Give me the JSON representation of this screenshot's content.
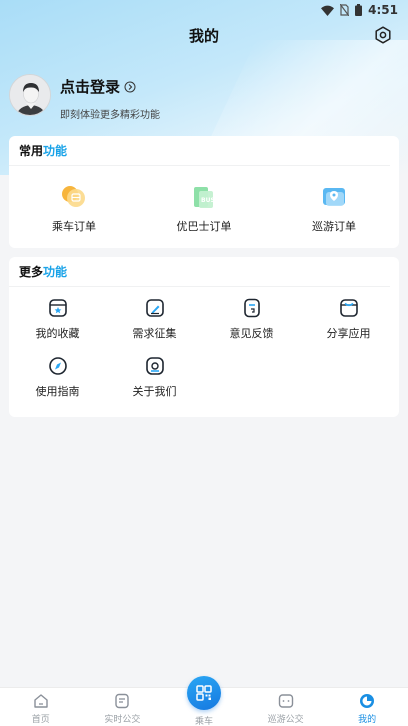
{
  "status_bar": {
    "time": "4:51"
  },
  "header": {
    "title": "我的"
  },
  "profile": {
    "login_label": "点击登录",
    "subtitle": "即刻体验更多精彩功能"
  },
  "common_section": {
    "title_dark": "常用",
    "title_accent": "功能",
    "items": [
      {
        "label": "乘车订单",
        "icon": "bus-order-icon"
      },
      {
        "label": "优巴士订单",
        "icon": "bus-ticket-icon"
      },
      {
        "label": "巡游订单",
        "icon": "map-pin-icon"
      }
    ]
  },
  "more_section": {
    "title_dark": "更多",
    "title_accent": "功能",
    "items": [
      {
        "label": "我的收藏",
        "icon": "star-box-icon"
      },
      {
        "label": "需求征集",
        "icon": "edit-icon"
      },
      {
        "label": "意见反馈",
        "icon": "feedback-icon"
      },
      {
        "label": "分享应用",
        "icon": "share-icon"
      },
      {
        "label": "使用指南",
        "icon": "compass-icon"
      },
      {
        "label": "关于我们",
        "icon": "about-icon"
      }
    ]
  },
  "tab_bar": {
    "items": [
      {
        "label": "首页",
        "icon": "home-icon"
      },
      {
        "label": "实时公交",
        "icon": "realtime-bus-icon"
      },
      {
        "label": "乘车",
        "icon": "qr-code-icon"
      },
      {
        "label": "巡游公交",
        "icon": "tour-bus-icon"
      },
      {
        "label": "我的",
        "icon": "profile-icon"
      }
    ],
    "active": "我的"
  },
  "colors": {
    "accent": "#1aa3e8",
    "tab_active": "#1a8fe3",
    "background": "#f4f5f7"
  }
}
